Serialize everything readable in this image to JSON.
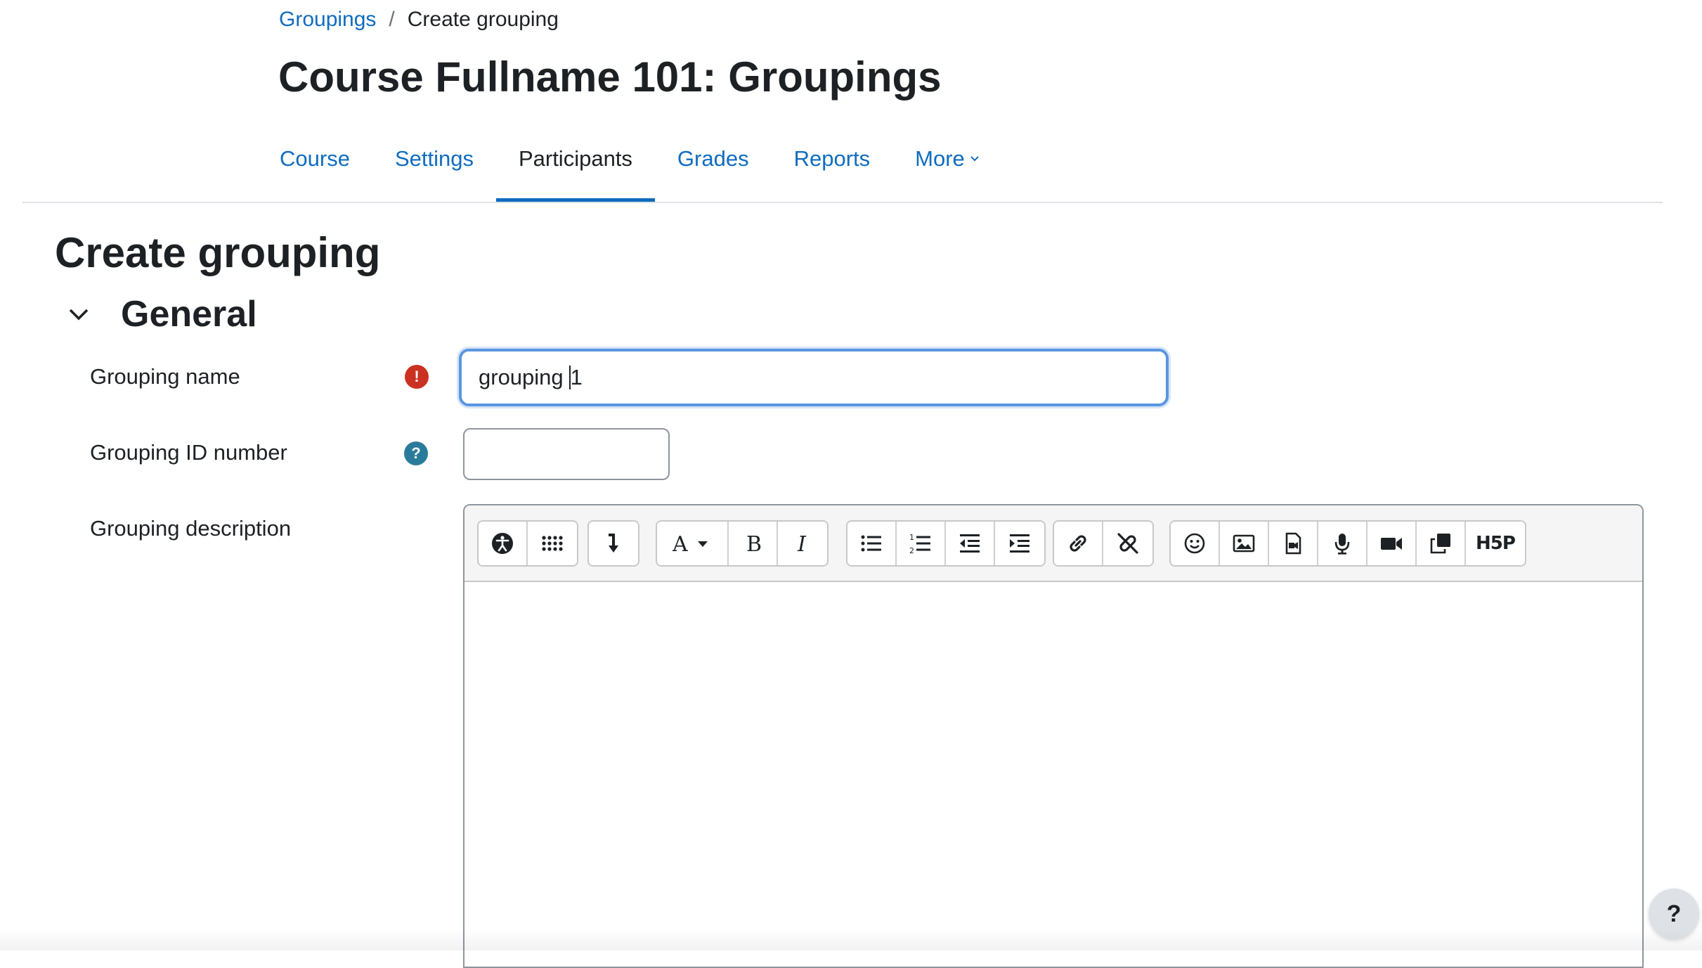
{
  "breadcrumb": {
    "parent": "Groupings",
    "separator": "/",
    "current": "Create grouping"
  },
  "page_title": "Course Fullname 101: Groupings",
  "tabs": [
    {
      "label": "Course"
    },
    {
      "label": "Settings"
    },
    {
      "label": "Participants",
      "active": true
    },
    {
      "label": "Grades"
    },
    {
      "label": "Reports"
    },
    {
      "label": "More"
    }
  ],
  "section_title": "Create grouping",
  "general": {
    "title": "General",
    "grouping_name": {
      "label": "Grouping name",
      "value": "grouping 1",
      "value_before_caret": "grouping",
      "value_after_caret": "1",
      "status": "required"
    },
    "grouping_id": {
      "label": "Grouping ID number",
      "value": ""
    },
    "grouping_description": {
      "label": "Grouping description",
      "value": ""
    }
  },
  "editor_toolbar": {
    "groups": [
      [
        "accessibility-checker-icon",
        "show-more-buttons-icon"
      ],
      [
        "collapse-toolbar-icon"
      ],
      [
        "text-style-icon",
        "bold-icon",
        "italic-icon"
      ],
      [
        "unordered-list-icon",
        "ordered-list-icon",
        "outdent-icon",
        "indent-icon"
      ],
      [
        "link-icon",
        "unlink-icon"
      ],
      [
        "emoji-icon",
        "image-icon",
        "media-icon",
        "record-audio-icon",
        "record-video-icon",
        "manage-files-icon",
        "h5p-icon"
      ]
    ],
    "h5p_label": "H5P"
  },
  "help_button": "?",
  "colors": {
    "link": "#0f6cbf",
    "error": "#ca3120",
    "help": "#2a7b9b",
    "focus": "#5a96e0"
  }
}
